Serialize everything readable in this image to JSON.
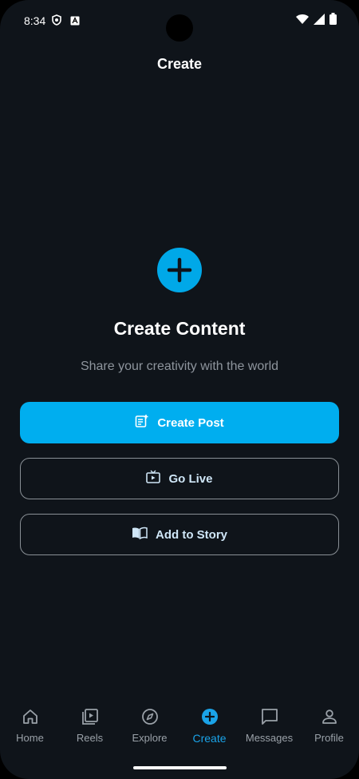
{
  "status": {
    "time": "8:34",
    "icons": [
      "shield-icon",
      "a-icon",
      "wifi-icon",
      "signal-icon",
      "battery-icon"
    ]
  },
  "header": {
    "title": "Create"
  },
  "hero": {
    "icon": "plus-icon",
    "title": "Create Content",
    "subtitle": "Share your creativity with the world"
  },
  "actions": {
    "create_post": "Create Post",
    "go_live": "Go Live",
    "add_story": "Add to Story"
  },
  "nav": {
    "items": [
      {
        "label": "Home",
        "icon": "home-icon"
      },
      {
        "label": "Reels",
        "icon": "reels-icon"
      },
      {
        "label": "Explore",
        "icon": "explore-icon"
      },
      {
        "label": "Create",
        "icon": "create-icon",
        "active": true
      },
      {
        "label": "Messages",
        "icon": "messages-icon"
      },
      {
        "label": "Profile",
        "icon": "profile-icon"
      }
    ]
  },
  "colors": {
    "background": "#0f141a",
    "accent": "#00aeef",
    "muted_text": "#8e959d"
  }
}
